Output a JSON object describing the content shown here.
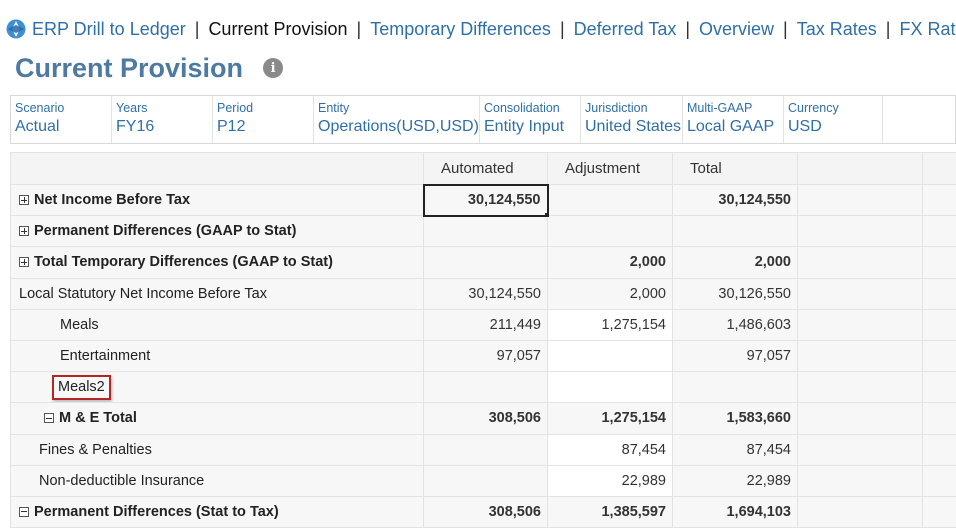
{
  "nav": {
    "items": [
      {
        "label": "ERP Drill to Ledger",
        "active": false
      },
      {
        "label": "Current Provision",
        "active": true
      },
      {
        "label": "Temporary Differences",
        "active": false
      },
      {
        "label": "Deferred Tax",
        "active": false
      },
      {
        "label": "Overview",
        "active": false
      },
      {
        "label": "Tax Rates",
        "active": false
      },
      {
        "label": "FX Rates",
        "active": false
      }
    ],
    "separator": "|"
  },
  "page": {
    "title": "Current Provision",
    "info_icon": "i"
  },
  "pov": [
    {
      "label": "Scenario",
      "value": "Actual"
    },
    {
      "label": "Years",
      "value": "FY16"
    },
    {
      "label": "Period",
      "value": "P12"
    },
    {
      "label": "Entity",
      "value": "Operations(USD,USD)"
    },
    {
      "label": "Consolidation",
      "value": "Entity Input"
    },
    {
      "label": "Jurisdiction",
      "value": "United States"
    },
    {
      "label": "Multi-GAAP",
      "value": "Local GAAP"
    },
    {
      "label": "Currency",
      "value": "USD"
    }
  ],
  "grid": {
    "columns": [
      "Automated",
      "Adjustment",
      "Total"
    ],
    "rows": [
      {
        "label": "Net Income Before Tax",
        "automated": "30,124,550",
        "adjustment": "",
        "total": "30,124,550"
      },
      {
        "label": "Permanent Differences (GAAP to Stat)",
        "automated": "",
        "adjustment": "",
        "total": ""
      },
      {
        "label": "Total Temporary Differences (GAAP to Stat)",
        "automated": "",
        "adjustment": "2,000",
        "total": "2,000"
      },
      {
        "label": "Local Statutory Net Income Before Tax",
        "automated": "30,124,550",
        "adjustment": "2,000",
        "total": "30,126,550"
      },
      {
        "label": "Meals",
        "automated": "211,449",
        "adjustment": "1,275,154",
        "total": "1,486,603"
      },
      {
        "label": "Entertainment",
        "automated": "97,057",
        "adjustment": "",
        "total": "97,057"
      },
      {
        "label": "Meals2",
        "automated": "",
        "adjustment": "",
        "total": ""
      },
      {
        "label": "M & E Total",
        "automated": "308,506",
        "adjustment": "1,275,154",
        "total": "1,583,660"
      },
      {
        "label": "Fines & Penalties",
        "automated": "",
        "adjustment": "87,454",
        "total": "87,454"
      },
      {
        "label": "Non-deductible Insurance",
        "automated": "",
        "adjustment": "22,989",
        "total": "22,989"
      },
      {
        "label": "Permanent Differences (Stat to Tax)",
        "automated": "308,506",
        "adjustment": "1,385,597",
        "total": "1,694,103"
      }
    ]
  },
  "colors": {
    "link": "#2f6fa8",
    "title": "#4e7aa1",
    "highlight_border": "#b42626"
  }
}
